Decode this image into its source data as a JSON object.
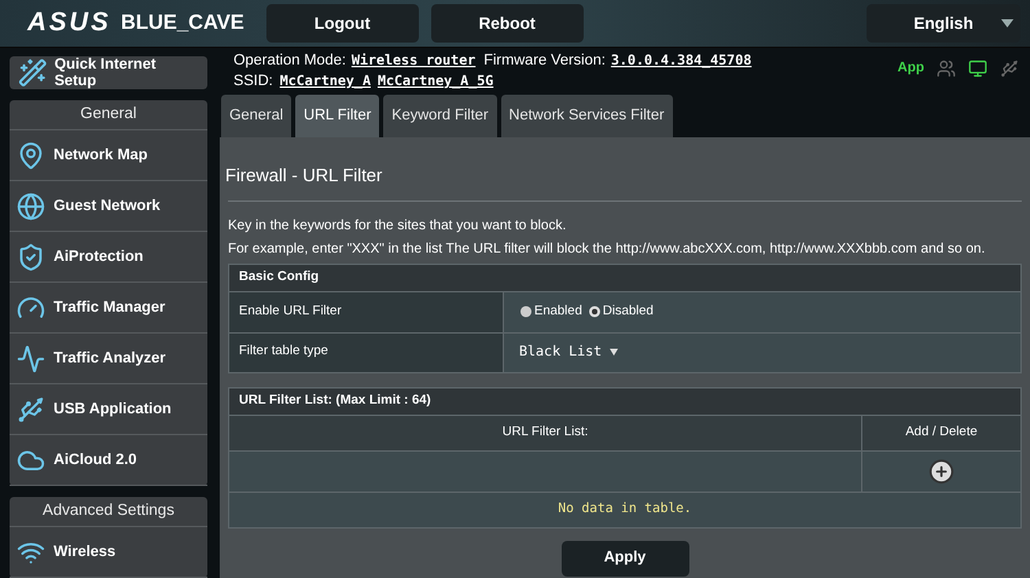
{
  "header": {
    "logo": "ASUS",
    "model": "BLUE_CAVE",
    "buttons": [
      "Logout",
      "Reboot"
    ],
    "language": "English"
  },
  "info": {
    "operation_mode_label": "Operation Mode:",
    "operation_mode": "Wireless router",
    "firmware_label": "Firmware Version:",
    "firmware": "3.0.0.4.384_45708",
    "ssid_label": "SSID:",
    "ssids": [
      "McCartney_A",
      "McCartney_A_5G"
    ],
    "app_label": "App"
  },
  "sidebar": {
    "quick_setup": "Quick Internet Setup",
    "sections": [
      {
        "title": "General",
        "items": [
          {
            "label": "Network Map"
          },
          {
            "label": "Guest Network"
          },
          {
            "label": "AiProtection"
          },
          {
            "label": "Traffic Manager"
          },
          {
            "label": "Traffic Analyzer"
          },
          {
            "label": "USB Application"
          },
          {
            "label": "AiCloud 2.0"
          }
        ]
      },
      {
        "title": "Advanced Settings",
        "items": [
          {
            "label": "Wireless"
          }
        ]
      }
    ]
  },
  "tabs": [
    {
      "label": "General",
      "selected": false
    },
    {
      "label": "URL Filter",
      "selected": true
    },
    {
      "label": "Keyword Filter",
      "selected": false
    },
    {
      "label": "Network Services Filter",
      "selected": false
    }
  ],
  "page": {
    "title": "Firewall - URL Filter",
    "description": [
      "Key in the keywords for the sites that you want to block.",
      "For example, enter \"XXX\" in the list The URL filter will block the http://www.abcXXX.com, http://www.XXXbbb.com and so on."
    ]
  },
  "basic_config": {
    "title": "Basic Config",
    "enable_label": "Enable URL Filter",
    "options": [
      {
        "label": "Enabled",
        "selected": false
      },
      {
        "label": "Disabled",
        "selected": true
      }
    ],
    "type_label": "Filter table type",
    "type_value": "Black List"
  },
  "url_list": {
    "title": "URL Filter List: (Max Limit : 64)",
    "columns": [
      "URL Filter List:",
      "Add / Delete"
    ],
    "empty_message": "No data in table."
  },
  "apply_button": "Apply"
}
